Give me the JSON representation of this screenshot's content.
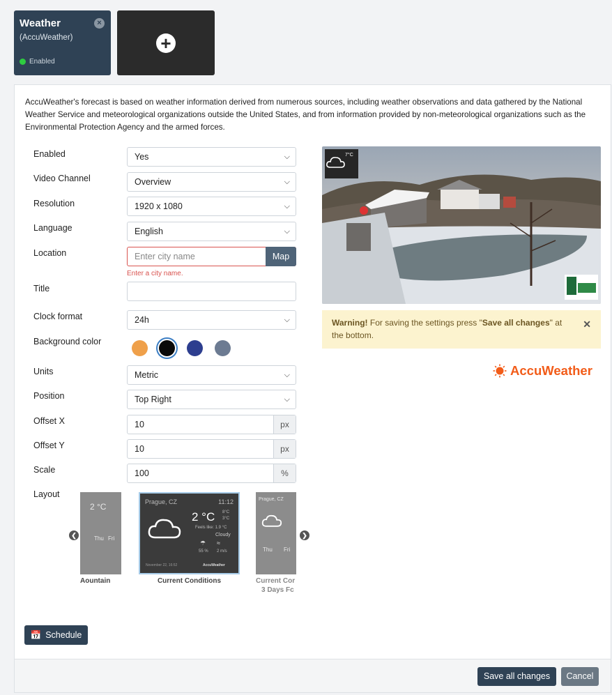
{
  "tiles": {
    "weather": {
      "title": "Weather",
      "subtitle": "(AccuWeather)",
      "status": "Enabled"
    }
  },
  "description": "AccuWeather's forecast is based on weather information derived from numerous sources, including weather observations and data gathered by the National Weather Service and meteorological organizations outside the United States, and from information provided by non-meteorological organizations such as the Environmental Protection Agency and the armed forces.",
  "form": {
    "enabled": {
      "label": "Enabled",
      "value": "Yes"
    },
    "video_channel": {
      "label": "Video Channel",
      "value": "Overview"
    },
    "resolution": {
      "label": "Resolution",
      "value": "1920 x 1080"
    },
    "language": {
      "label": "Language",
      "value": "English"
    },
    "location": {
      "label": "Location",
      "placeholder": "Enter city name",
      "map_label": "Map",
      "error": "Enter a city name."
    },
    "title": {
      "label": "Title",
      "value": ""
    },
    "clock_format": {
      "label": "Clock format",
      "value": "24h"
    },
    "background_color": {
      "label": "Background color",
      "colors": [
        "#efa04a",
        "#0a0a0a",
        "#2d3e8f",
        "#6c7b92"
      ],
      "selected_index": 1
    },
    "units": {
      "label": "Units",
      "value": "Metric"
    },
    "position": {
      "label": "Position",
      "value": "Top Right"
    },
    "offset_x": {
      "label": "Offset X",
      "value": "10",
      "unit": "px"
    },
    "offset_y": {
      "label": "Offset Y",
      "value": "10",
      "unit": "px"
    },
    "scale": {
      "label": "Scale",
      "value": "100",
      "unit": "%"
    },
    "layout": {
      "label": "Layout",
      "options": [
        {
          "caption": "Mountain",
          "partial_caption": "Aountain"
        },
        {
          "caption": "Current Conditions",
          "city": "Prague, CZ",
          "time": "11:12",
          "temp": "2 °C",
          "hi": "8°C",
          "lo": "3°C",
          "feels": "Feels like: 1.9 °C",
          "cond": "Cloudy",
          "precip": "55 %",
          "wind": "2 m/s",
          "date": "November 22, 16:52",
          "brand": "AccuWeather"
        },
        {
          "caption": "Current Cor",
          "caption2": "3 Days Fc",
          "city": "Prague, CZ"
        }
      ]
    }
  },
  "preview": {
    "overlay_temp": "7°C"
  },
  "warning": {
    "strong": "Warning!",
    "text_before": " For saving the settings press \"",
    "bold_action": "Save all changes",
    "text_after": "\" at the bottom."
  },
  "brand": {
    "name": "AccuWeather"
  },
  "buttons": {
    "schedule": "Schedule",
    "save": "Save all changes",
    "cancel": "Cancel"
  }
}
